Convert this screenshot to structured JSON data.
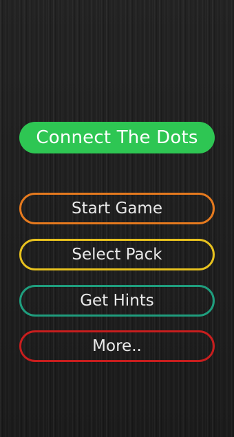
{
  "title": {
    "label": "Connect The Dots",
    "color": "#2ec653"
  },
  "menu": {
    "items": [
      {
        "label": "Start Game",
        "color": "#e67a1e"
      },
      {
        "label": "Select Pack",
        "color": "#e8c21e"
      },
      {
        "label": "Get Hints",
        "color": "#1f9e7e"
      },
      {
        "label": "More..",
        "color": "#c81e1e"
      }
    ]
  }
}
